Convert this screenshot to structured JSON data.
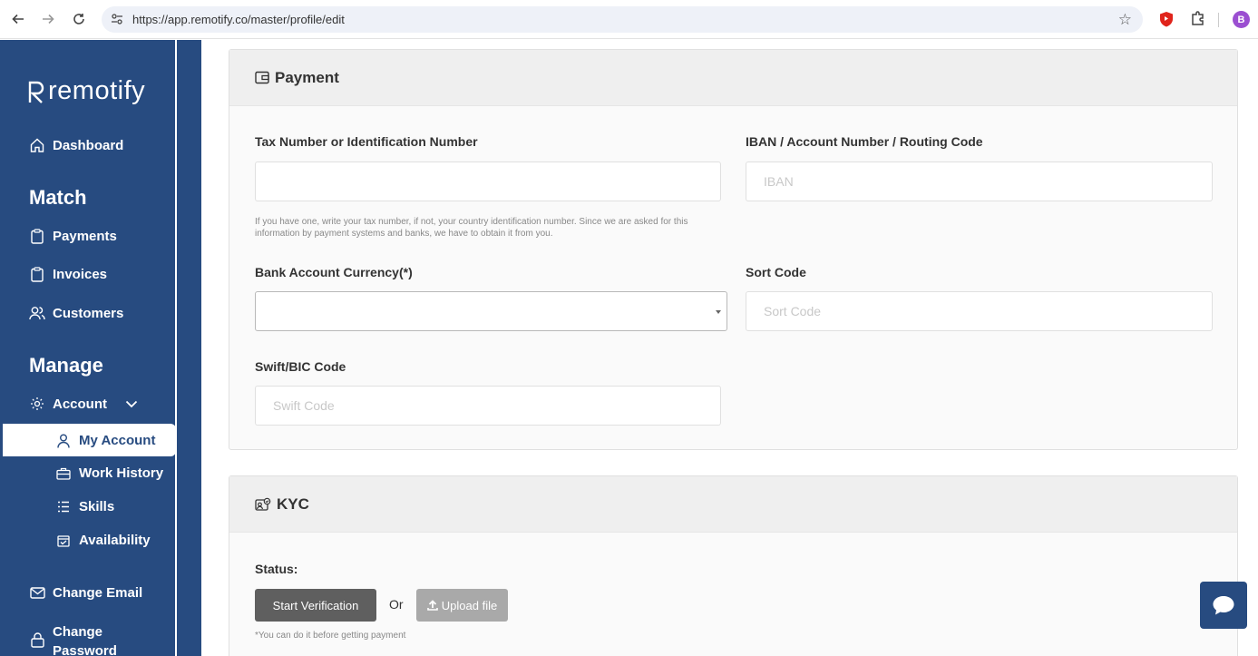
{
  "browser": {
    "url": "https://app.remotify.co/master/profile/edit",
    "profile_initial": "B"
  },
  "sidebar": {
    "logo_text": "remotify",
    "dashboard": "Dashboard",
    "section_match": "Match",
    "payments": "Payments",
    "invoices": "Invoices",
    "customers": "Customers",
    "section_manage": "Manage",
    "account": "Account",
    "my_account": "My Account",
    "work_history": "Work History",
    "skills": "Skills",
    "availability": "Availability",
    "change_email": "Change Email",
    "change_password_line1": "Change",
    "change_password_line2": "Password"
  },
  "payment": {
    "title": "Payment",
    "tax_label": "Tax Number or Identification Number",
    "tax_value": "",
    "tax_help": "If you have one, write your tax number, if not, your country identification number. Since we are asked for this information by payment systems and banks, we have to obtain it from you.",
    "iban_label": "IBAN / Account Number / Routing Code",
    "iban_placeholder": "IBAN",
    "currency_label": "Bank Account Currency(*)",
    "currency_value": "",
    "sort_label": "Sort Code",
    "sort_placeholder": "Sort Code",
    "swift_label": "Swift/BIC Code",
    "swift_placeholder": "Swift Code"
  },
  "kyc": {
    "title": "KYC",
    "status_label": "Status:",
    "start_button": "Start Verification",
    "or_text": "Or",
    "upload_button": "Upload file",
    "note": "*You can do it before getting payment"
  },
  "colors": {
    "sidebar_bg": "#274b80",
    "card_header_bg": "#efefef",
    "dark_button": "#5f5f5f",
    "upload_button": "#a9a9a9"
  }
}
